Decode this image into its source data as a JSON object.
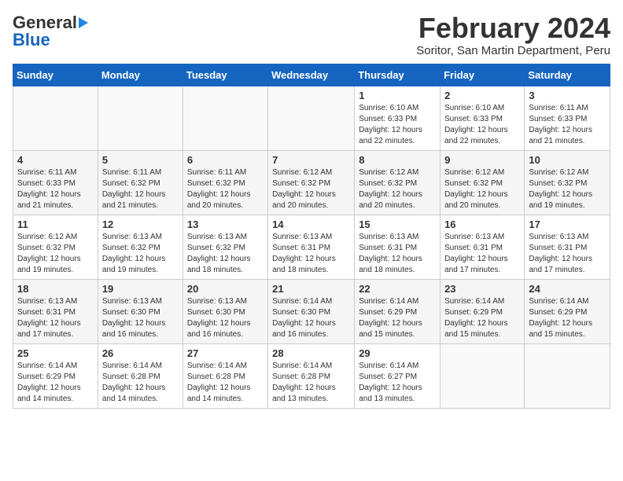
{
  "header": {
    "logo_line1": "General",
    "logo_line2": "Blue",
    "month_year": "February 2024",
    "location": "Soritor, San Martin Department, Peru"
  },
  "weekdays": [
    "Sunday",
    "Monday",
    "Tuesday",
    "Wednesday",
    "Thursday",
    "Friday",
    "Saturday"
  ],
  "weeks": [
    [
      {
        "day": "",
        "content": ""
      },
      {
        "day": "",
        "content": ""
      },
      {
        "day": "",
        "content": ""
      },
      {
        "day": "",
        "content": ""
      },
      {
        "day": "1",
        "content": "Sunrise: 6:10 AM\nSunset: 6:33 PM\nDaylight: 12 hours\nand 22 minutes."
      },
      {
        "day": "2",
        "content": "Sunrise: 6:10 AM\nSunset: 6:33 PM\nDaylight: 12 hours\nand 22 minutes."
      },
      {
        "day": "3",
        "content": "Sunrise: 6:11 AM\nSunset: 6:33 PM\nDaylight: 12 hours\nand 21 minutes."
      }
    ],
    [
      {
        "day": "4",
        "content": "Sunrise: 6:11 AM\nSunset: 6:33 PM\nDaylight: 12 hours\nand 21 minutes."
      },
      {
        "day": "5",
        "content": "Sunrise: 6:11 AM\nSunset: 6:32 PM\nDaylight: 12 hours\nand 21 minutes."
      },
      {
        "day": "6",
        "content": "Sunrise: 6:11 AM\nSunset: 6:32 PM\nDaylight: 12 hours\nand 20 minutes."
      },
      {
        "day": "7",
        "content": "Sunrise: 6:12 AM\nSunset: 6:32 PM\nDaylight: 12 hours\nand 20 minutes."
      },
      {
        "day": "8",
        "content": "Sunrise: 6:12 AM\nSunset: 6:32 PM\nDaylight: 12 hours\nand 20 minutes."
      },
      {
        "day": "9",
        "content": "Sunrise: 6:12 AM\nSunset: 6:32 PM\nDaylight: 12 hours\nand 20 minutes."
      },
      {
        "day": "10",
        "content": "Sunrise: 6:12 AM\nSunset: 6:32 PM\nDaylight: 12 hours\nand 19 minutes."
      }
    ],
    [
      {
        "day": "11",
        "content": "Sunrise: 6:12 AM\nSunset: 6:32 PM\nDaylight: 12 hours\nand 19 minutes."
      },
      {
        "day": "12",
        "content": "Sunrise: 6:13 AM\nSunset: 6:32 PM\nDaylight: 12 hours\nand 19 minutes."
      },
      {
        "day": "13",
        "content": "Sunrise: 6:13 AM\nSunset: 6:32 PM\nDaylight: 12 hours\nand 18 minutes."
      },
      {
        "day": "14",
        "content": "Sunrise: 6:13 AM\nSunset: 6:31 PM\nDaylight: 12 hours\nand 18 minutes."
      },
      {
        "day": "15",
        "content": "Sunrise: 6:13 AM\nSunset: 6:31 PM\nDaylight: 12 hours\nand 18 minutes."
      },
      {
        "day": "16",
        "content": "Sunrise: 6:13 AM\nSunset: 6:31 PM\nDaylight: 12 hours\nand 17 minutes."
      },
      {
        "day": "17",
        "content": "Sunrise: 6:13 AM\nSunset: 6:31 PM\nDaylight: 12 hours\nand 17 minutes."
      }
    ],
    [
      {
        "day": "18",
        "content": "Sunrise: 6:13 AM\nSunset: 6:31 PM\nDaylight: 12 hours\nand 17 minutes."
      },
      {
        "day": "19",
        "content": "Sunrise: 6:13 AM\nSunset: 6:30 PM\nDaylight: 12 hours\nand 16 minutes."
      },
      {
        "day": "20",
        "content": "Sunrise: 6:13 AM\nSunset: 6:30 PM\nDaylight: 12 hours\nand 16 minutes."
      },
      {
        "day": "21",
        "content": "Sunrise: 6:14 AM\nSunset: 6:30 PM\nDaylight: 12 hours\nand 16 minutes."
      },
      {
        "day": "22",
        "content": "Sunrise: 6:14 AM\nSunset: 6:29 PM\nDaylight: 12 hours\nand 15 minutes."
      },
      {
        "day": "23",
        "content": "Sunrise: 6:14 AM\nSunset: 6:29 PM\nDaylight: 12 hours\nand 15 minutes."
      },
      {
        "day": "24",
        "content": "Sunrise: 6:14 AM\nSunset: 6:29 PM\nDaylight: 12 hours\nand 15 minutes."
      }
    ],
    [
      {
        "day": "25",
        "content": "Sunrise: 6:14 AM\nSunset: 6:29 PM\nDaylight: 12 hours\nand 14 minutes."
      },
      {
        "day": "26",
        "content": "Sunrise: 6:14 AM\nSunset: 6:28 PM\nDaylight: 12 hours\nand 14 minutes."
      },
      {
        "day": "27",
        "content": "Sunrise: 6:14 AM\nSunset: 6:28 PM\nDaylight: 12 hours\nand 14 minutes."
      },
      {
        "day": "28",
        "content": "Sunrise: 6:14 AM\nSunset: 6:28 PM\nDaylight: 12 hours\nand 13 minutes."
      },
      {
        "day": "29",
        "content": "Sunrise: 6:14 AM\nSunset: 6:27 PM\nDaylight: 12 hours\nand 13 minutes."
      },
      {
        "day": "",
        "content": ""
      },
      {
        "day": "",
        "content": ""
      }
    ]
  ]
}
